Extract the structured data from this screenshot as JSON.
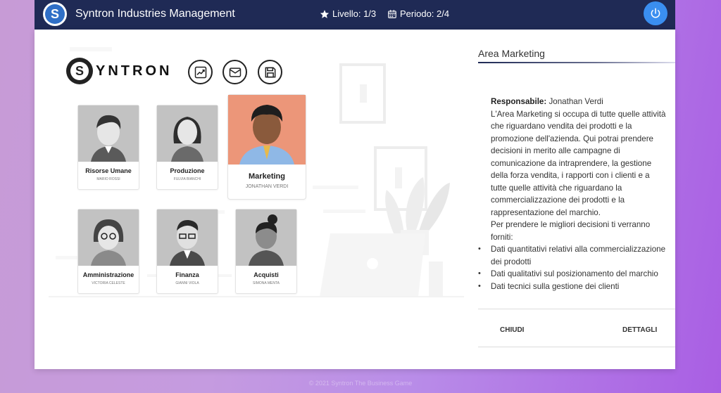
{
  "app": {
    "title": "Syntron Industries Management",
    "logo_letter": "S"
  },
  "stats": {
    "level": "Livello: 1/3",
    "period": "Periodo: 2/4"
  },
  "brand": {
    "letter": "S",
    "text": "YNTRON"
  },
  "tools": [
    {
      "icon": "chart-icon"
    },
    {
      "icon": "mail-icon"
    },
    {
      "icon": "save-icon"
    }
  ],
  "departments": [
    {
      "name": "Risorse Umane",
      "person": "MARIO ROSSI"
    },
    {
      "name": "Produzione",
      "person": "FULVIA BIANCHI"
    },
    {
      "name": "Marketing",
      "person": "JONATHAN VERDI"
    },
    {
      "name": "Amministrazione",
      "person": "VICTORIA CELESTE"
    },
    {
      "name": "Finanza",
      "person": "GIANNI VIOLA"
    },
    {
      "name": "Acquisti",
      "person": "SIMONA MENTA"
    }
  ],
  "detail": {
    "title": "Area Marketing",
    "resp_label": "Responsabile:",
    "resp_name": "Jonathan Verdi",
    "description": "L'Area Marketing si occupa di tutte quelle attività che riguardano vendita dei prodotti e la promozione dell'azienda. Qui potrai prendere decisioni in merito alle campagne di comunicazione da intraprendere, la gestione della forza vendita, i rapporti con i clienti e a tutte quelle attività che riguardano la commercializzazione dei prodotti e la rappresentazione del marchio.",
    "intro": "Per prendere le migliori decisioni ti verranno forniti:",
    "bullets": [
      "Dati quantitativi relativi alla commercializzazione dei prodotti",
      "Dati qualitativi sul posizionamento del marchio",
      "Dati tecnici sulla gestione dei clienti"
    ],
    "close_label": "CHIUDI",
    "details_label": "DETTAGLI"
  },
  "footer": "© 2021 Syntron The Business Game",
  "colors": {
    "topbar": "#1f2a55",
    "power": "#3a8ef0",
    "marketing_card": "#ec9679"
  }
}
